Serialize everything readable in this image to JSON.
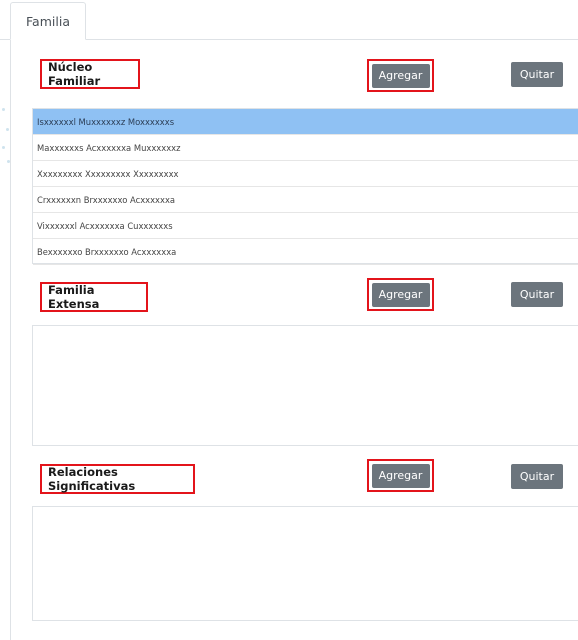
{
  "tabs": [
    {
      "label": "Familia",
      "active": true
    }
  ],
  "sections": {
    "nucleo": {
      "title": "Núcleo Familiar",
      "add_label": "Agregar",
      "remove_label": "Quitar",
      "members": [
        "Isxxxxxxl Muxxxxxxz Moxxxxxxs",
        "Maxxxxxxs Acxxxxxxa Muxxxxxxz",
        "Xxxxxxxxx Xxxxxxxxx Xxxxxxxxx",
        "Crxxxxxxn Brxxxxxxo Acxxxxxxa",
        "Vixxxxxxl Acxxxxxxa Cuxxxxxxs",
        "Bexxxxxxo Brxxxxxxo Acxxxxxxa"
      ],
      "selected_index": 0
    },
    "extensa": {
      "title": "Familia Extensa",
      "add_label": "Agregar",
      "remove_label": "Quitar"
    },
    "relaciones": {
      "title": "Relaciones Significativas",
      "add_label": "Agregar",
      "remove_label": "Quitar"
    }
  },
  "colors": {
    "highlight_border": "#e3141b",
    "button_bg": "#6c757d",
    "selected_row_bg": "#8fc1f3"
  }
}
